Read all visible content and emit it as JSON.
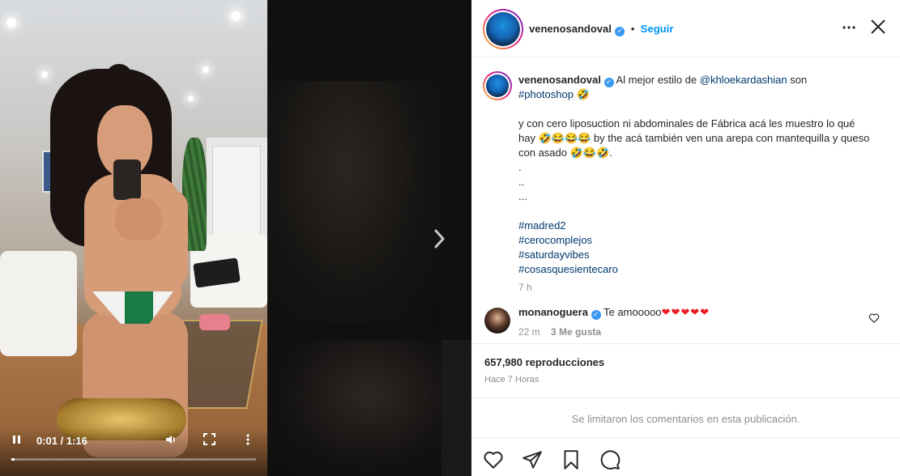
{
  "video": {
    "time": "0:01 / 1:16",
    "progress": 0.013,
    "icons": [
      "pause-icon",
      "volume-icon",
      "fullscreen-icon",
      "more-vertical-icon"
    ]
  },
  "navigation": {
    "next_icon": "chevron-right-icon"
  },
  "post": {
    "author": "venenosandoval",
    "follow_label": "Seguir",
    "caption": {
      "intro_text": "Al mejor estilo de",
      "mention": "@khloekardashian",
      "son": "son",
      "hashtag_first": "#photoshop",
      "emoji_1": "🤣",
      "body": "y con cero liposuction ni abdominales de Fábrica acá les muestro lo qué hay 🤣😂😂😂 by the acá también ven una arepa con mantequilla y queso con asado 🤣😂🤣.",
      "dots": [
        ".",
        "..",
        "..."
      ],
      "hashtags": [
        "#madred2",
        "#cerocomplejos",
        "#saturdayvibes",
        "#cosasquesientecaro"
      ]
    },
    "time_ago": "7 h",
    "comment": {
      "author": "monanoguera",
      "text": "Te amooooo",
      "hearts": "❤❤❤❤❤",
      "time": "22 m",
      "likes": "3 Me gusta"
    },
    "views": "657,980 reproducciones",
    "date": "Hace 7 Horas",
    "comments_limited": "Se limitaron los comentarios en esta publicación.",
    "action_icons": [
      "heart-icon",
      "share-icon",
      "bookmark-icon",
      "comment-icon"
    ]
  }
}
